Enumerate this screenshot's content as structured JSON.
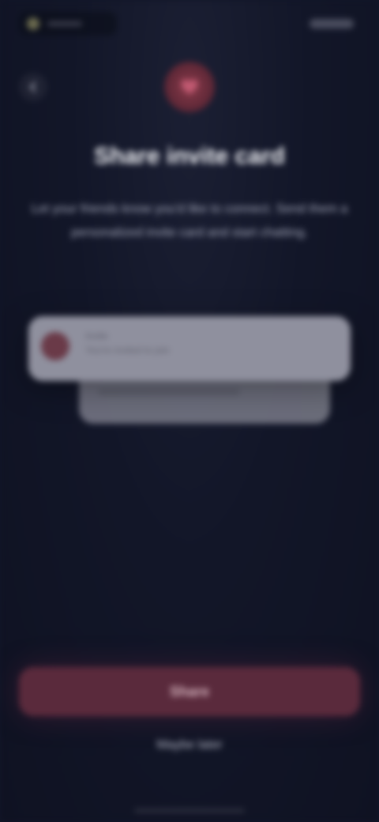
{
  "app": {
    "title": "Share invite card"
  },
  "header": {
    "back_icon": "chevron-left-icon",
    "hero_icon": "heart-icon"
  },
  "main": {
    "title": "Share invite card",
    "description": "Let your friends know you'd like to connect. Send them a personalized invite card and start chatting."
  },
  "preview": {
    "name": "Invite",
    "text": "You're invited to join"
  },
  "actions": {
    "primary_label": "Share",
    "secondary_label": "Maybe later"
  },
  "colors": {
    "background": "#121628",
    "accent": "#5a2a3c",
    "card": "#8f909e"
  }
}
